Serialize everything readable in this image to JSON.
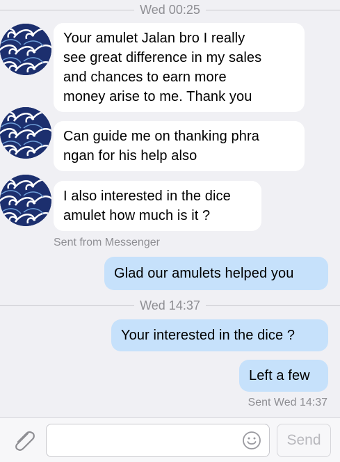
{
  "thread": {
    "timestamp_1": "Wed 00:25",
    "timestamp_2": "Wed 14:37",
    "incoming": [
      {
        "lines": [
          "Your amulet Jalan bro I really",
          "see great difference in my sales",
          "and chances to earn more",
          "money arise to me. Thank you"
        ]
      },
      {
        "lines": [
          "Can guide me on thanking phra",
          "ngan for his help also"
        ]
      },
      {
        "lines": [
          "I also interested in the dice",
          "amulet how much is it ?"
        ]
      }
    ],
    "incoming_meta": "Sent from Messenger",
    "outgoing": [
      {
        "text": "Glad our amulets helped you"
      },
      {
        "text": "Your interested in the dice ?"
      },
      {
        "text": "Left a few"
      }
    ],
    "outgoing_meta": "Sent Wed 14:37"
  },
  "composer": {
    "placeholder": "",
    "send_label": "Send",
    "attach_icon": "paperclip-icon",
    "emoji_icon": "smiley-icon"
  },
  "colors": {
    "background": "#f0f0f4",
    "incoming_bubble": "#ffffff",
    "outgoing_bubble": "#c6e1fb",
    "meta_text": "#8e8e93",
    "avatar_dark": "#1c2f6e"
  }
}
